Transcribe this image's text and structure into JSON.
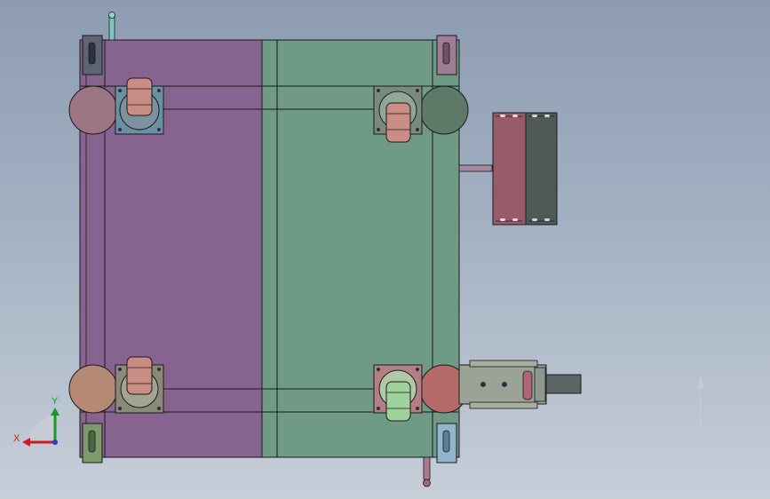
{
  "app": {
    "view": "top view"
  },
  "triad": {
    "x_label": "X",
    "y_label": "Y",
    "x_color": "#cc1d1d",
    "y_color": "#1a9a2a",
    "z_color": "#2a3fbf"
  },
  "colors": {
    "left_panel": "#87638f",
    "right_panel": "#6e9a86",
    "bracket_pink": "#995a6a",
    "bracket_dark": "#4f5a58",
    "wheel_copper": "#c98d84",
    "wheel_green": "#9ed29a",
    "roller_pink": "#9c7682",
    "roller_tan": "#b48a74",
    "roller_dark_green": "#5d7a68",
    "roller_red": "#b46a68",
    "outline": "#1b1b1b"
  },
  "parts": [
    "frame-left-panel",
    "frame-right-panel",
    "caster-top-left",
    "caster-top-right",
    "caster-bottom-left",
    "caster-bottom-right",
    "side-bracket-assembly",
    "motor-mount-assembly",
    "top-handle",
    "bottom-handle"
  ]
}
